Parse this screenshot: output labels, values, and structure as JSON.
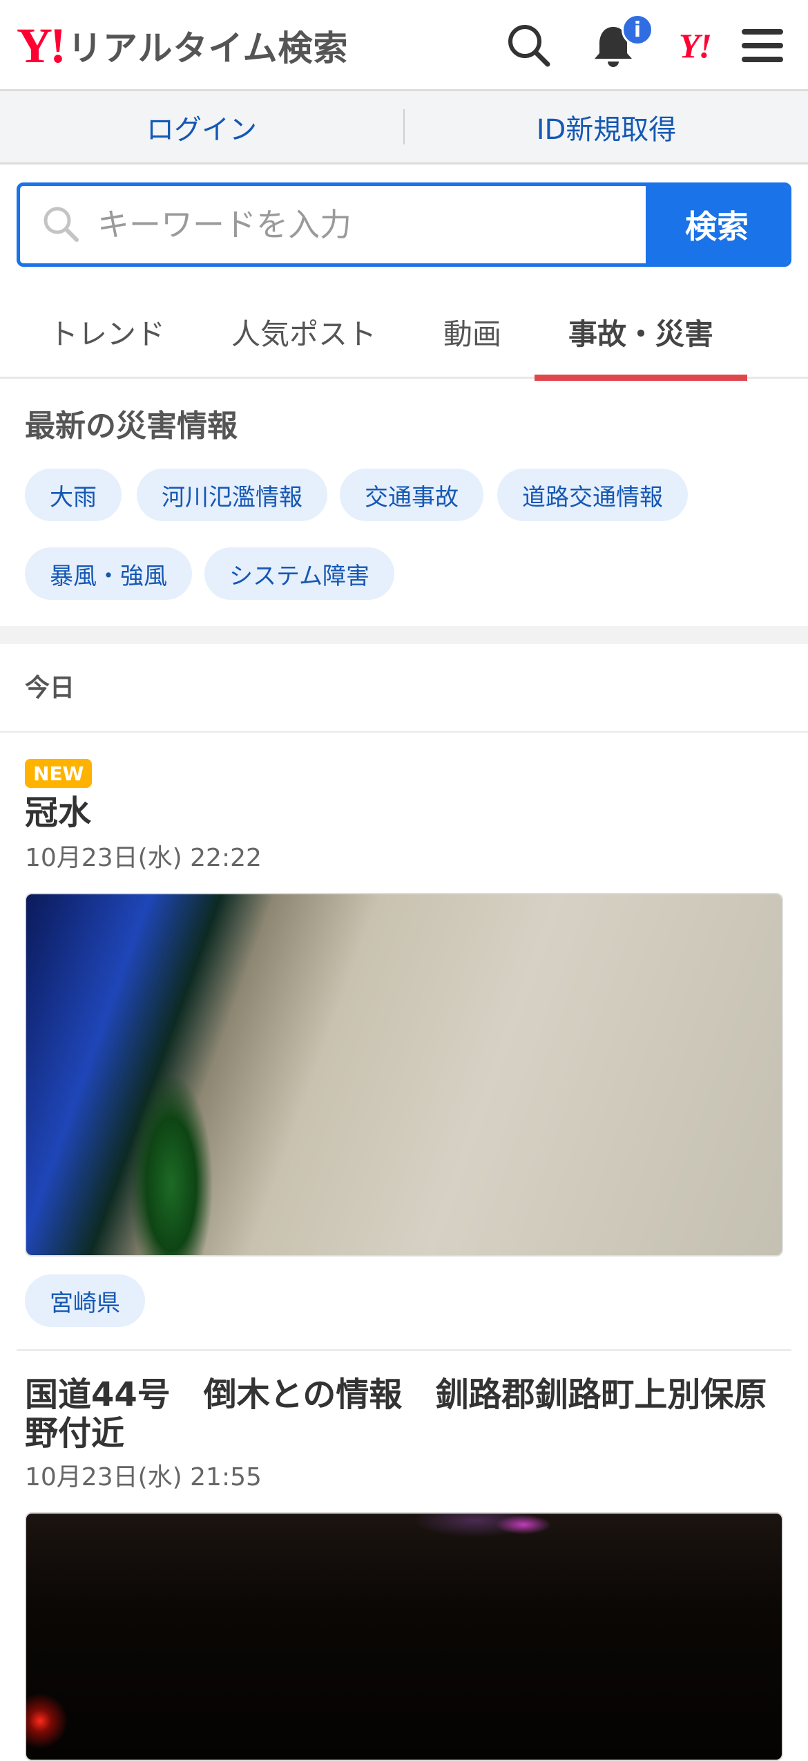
{
  "header": {
    "logo_mark": "Y!",
    "logo_text": "リアルタイム検索",
    "notification_badge": "i",
    "yahoo_mark": "Y!"
  },
  "auth": {
    "login": "ログイン",
    "register": "ID新規取得"
  },
  "search": {
    "placeholder": "キーワードを入力",
    "button": "検索"
  },
  "tabs": [
    {
      "label": "トレンド",
      "active": false
    },
    {
      "label": "人気ポスト",
      "active": false
    },
    {
      "label": "動画",
      "active": false
    },
    {
      "label": "事故・災害",
      "active": true
    }
  ],
  "disaster": {
    "title": "最新の災害情報",
    "chips": [
      "大雨",
      "河川氾濫情報",
      "交通事故",
      "道路交通情報",
      "暴風・強風",
      "システム障害"
    ]
  },
  "day_label": "今日",
  "posts": [
    {
      "badge": "NEW",
      "title": "冠水",
      "date": "10月23日(水) 22:22",
      "tag": "宮崎県"
    },
    {
      "title_line1": "国道44号　倒木との情報　釧路郡釧路町上別保原",
      "title_line2": "野付近",
      "date": "10月23日(水) 21:55"
    }
  ],
  "colors": {
    "accent": "#1a73e8",
    "brand_red": "#ff0033",
    "tab_indicator": "#e0474c",
    "new_badge": "#ffb300"
  }
}
